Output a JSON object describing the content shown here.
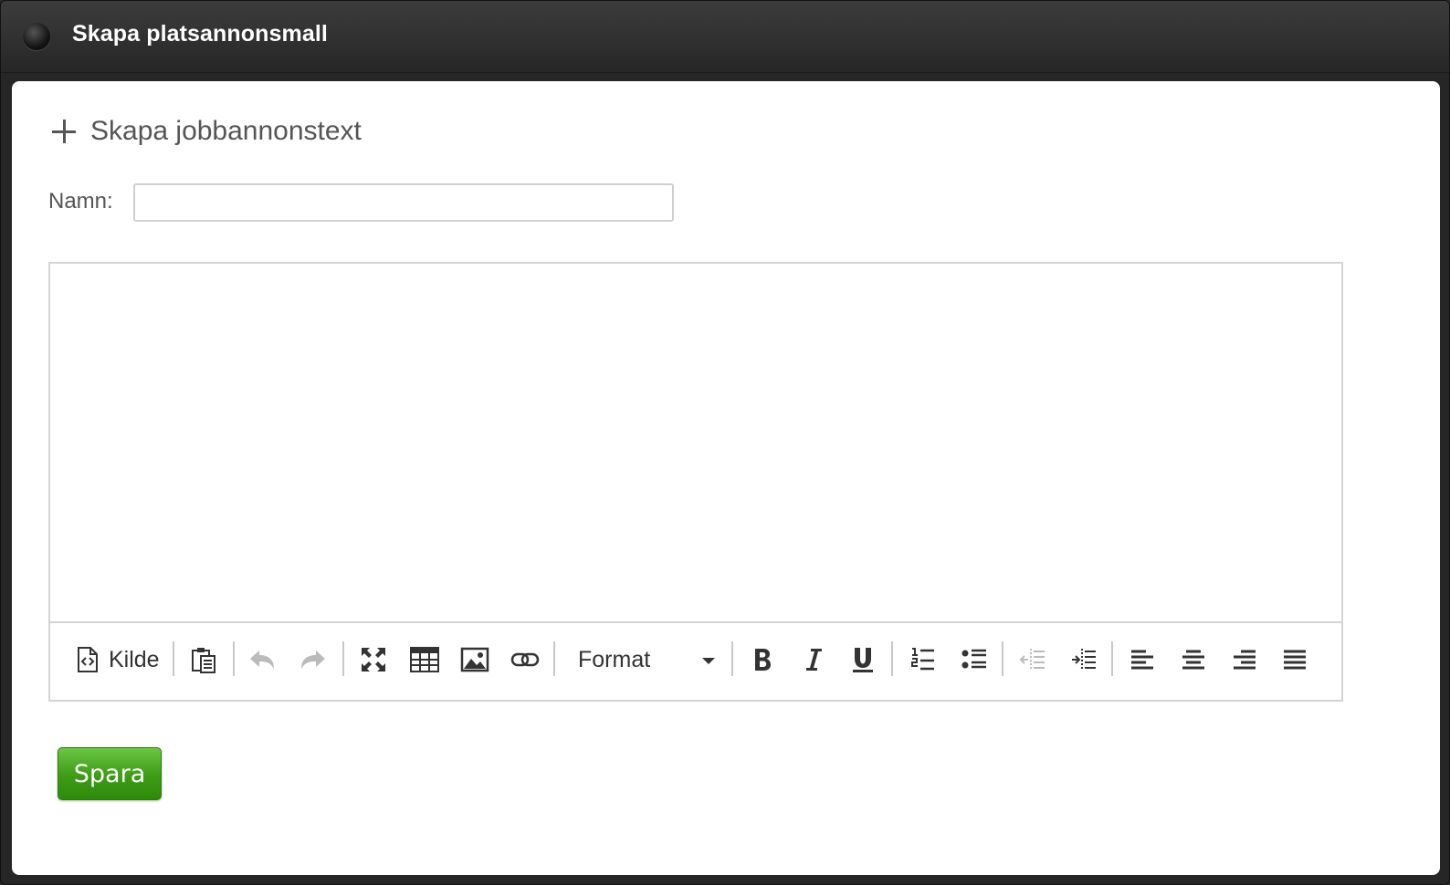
{
  "window": {
    "title": "Skapa platsannonsmall"
  },
  "form": {
    "heading": "Skapa jobbannonstext",
    "name_label": "Namn:",
    "name_value": "",
    "save_label": "Spara"
  },
  "editor": {
    "content": "",
    "toolbar": {
      "source_label": "Kilde",
      "format_label": "Format",
      "buttons": [
        "source-icon",
        "paste-icon",
        "undo-icon",
        "redo-icon",
        "maximize-icon",
        "table-icon",
        "image-icon",
        "link-icon",
        "bold-icon",
        "italic-icon",
        "underline-icon",
        "numbered-list-icon",
        "bulleted-list-icon",
        "outdent-icon",
        "indent-icon",
        "align-left-icon",
        "align-center-icon",
        "align-right-icon",
        "align-justify-icon"
      ]
    }
  },
  "colors": {
    "save_button": "#3d9b15",
    "title_bar": "#2b2b2b"
  }
}
